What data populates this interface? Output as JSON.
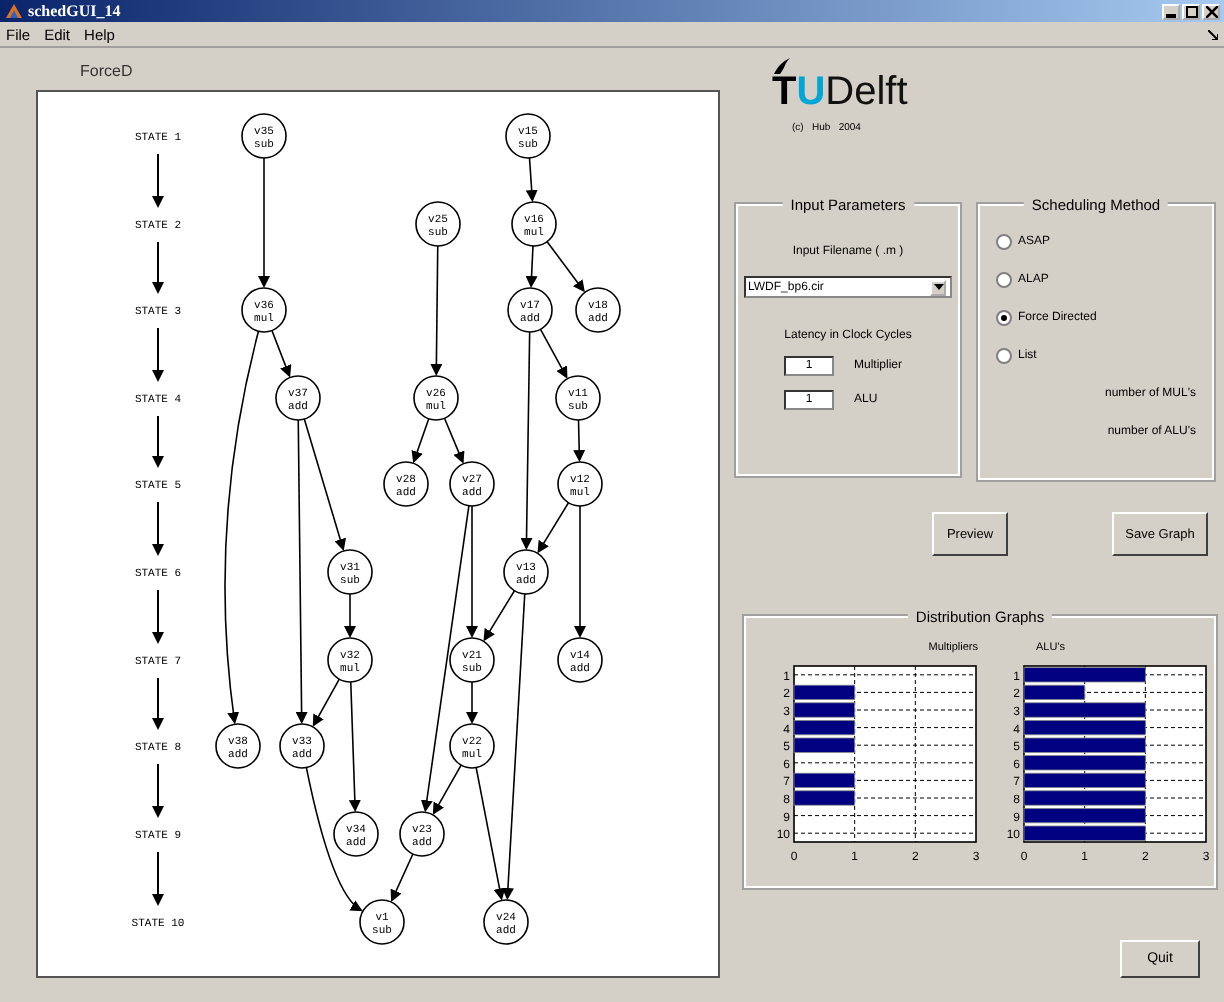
{
  "window": {
    "title": "schedGUI_14"
  },
  "menu": [
    "File",
    "Edit",
    "Help"
  ],
  "graph": {
    "title": "ForceD",
    "states": [
      "STATE 1",
      "STATE 2",
      "STATE 3",
      "STATE 4",
      "STATE 5",
      "STATE 6",
      "STATE 7",
      "STATE 8",
      "STATE 9",
      "STATE 10"
    ],
    "nodes": [
      {
        "name": "v35",
        "op": "sub"
      },
      {
        "name": "v15",
        "op": "sub"
      },
      {
        "name": "v25",
        "op": "sub"
      },
      {
        "name": "v16",
        "op": "mul"
      },
      {
        "name": "v36",
        "op": "mul"
      },
      {
        "name": "v17",
        "op": "add"
      },
      {
        "name": "v18",
        "op": "add"
      },
      {
        "name": "v37",
        "op": "add"
      },
      {
        "name": "v26",
        "op": "mul"
      },
      {
        "name": "v11",
        "op": "sub"
      },
      {
        "name": "v28",
        "op": "add"
      },
      {
        "name": "v27",
        "op": "add"
      },
      {
        "name": "v12",
        "op": "mul"
      },
      {
        "name": "v31",
        "op": "sub"
      },
      {
        "name": "v13",
        "op": "add"
      },
      {
        "name": "v32",
        "op": "mul"
      },
      {
        "name": "v21",
        "op": "sub"
      },
      {
        "name": "v14",
        "op": "add"
      },
      {
        "name": "v38",
        "op": "add"
      },
      {
        "name": "v33",
        "op": "add"
      },
      {
        "name": "v22",
        "op": "mul"
      },
      {
        "name": "v34",
        "op": "add"
      },
      {
        "name": "v23",
        "op": "add"
      },
      {
        "name": "v1",
        "op": "sub"
      },
      {
        "name": "v24",
        "op": "add"
      }
    ]
  },
  "logo": {
    "first": "T",
    "accent": "U",
    "rest": "Delft",
    "credit": "(c)   Hub   2004"
  },
  "input_parameters": {
    "title": "Input Parameters",
    "filename_label": "Input Filename  ( .m )",
    "filename": "LWDF_bp6.cir",
    "latency_label": "Latency in Clock Cycles",
    "fields": [
      {
        "value": "1",
        "label": "Multiplier"
      },
      {
        "value": "1",
        "label": "ALU"
      }
    ]
  },
  "scheduling_method": {
    "title": "Scheduling Method",
    "options": [
      {
        "label": "ASAP",
        "selected": false
      },
      {
        "label": "ALAP",
        "selected": false
      },
      {
        "label": "Force Directed",
        "selected": true
      },
      {
        "label": "List",
        "selected": false
      }
    ],
    "counts": [
      "number of MUL's",
      "number of ALU's"
    ]
  },
  "buttons": [
    "Preview",
    "Save Graph"
  ],
  "distribution": {
    "title": "Distribution Graphs",
    "charts": [
      {
        "chart_data": {
          "type": "bar",
          "orientation": "horizontal",
          "title": "Multipliers",
          "categories": [
            "1",
            "2",
            "3",
            "4",
            "5",
            "6",
            "7",
            "8",
            "9",
            "10"
          ],
          "values": [
            0,
            1,
            1,
            1,
            1,
            0,
            1,
            1,
            0,
            0
          ],
          "xlim": [
            0,
            3
          ],
          "xticks": [
            0,
            1,
            2,
            3
          ]
        }
      },
      {
        "chart_data": {
          "type": "bar",
          "orientation": "horizontal",
          "title": "ALU's",
          "categories": [
            "1",
            "2",
            "3",
            "4",
            "5",
            "6",
            "7",
            "8",
            "9",
            "10"
          ],
          "values": [
            2,
            1,
            2,
            2,
            2,
            2,
            2,
            2,
            2,
            2
          ],
          "xlim": [
            0,
            3
          ],
          "xticks": [
            0,
            1,
            2,
            3
          ]
        }
      }
    ]
  },
  "quit": "Quit"
}
